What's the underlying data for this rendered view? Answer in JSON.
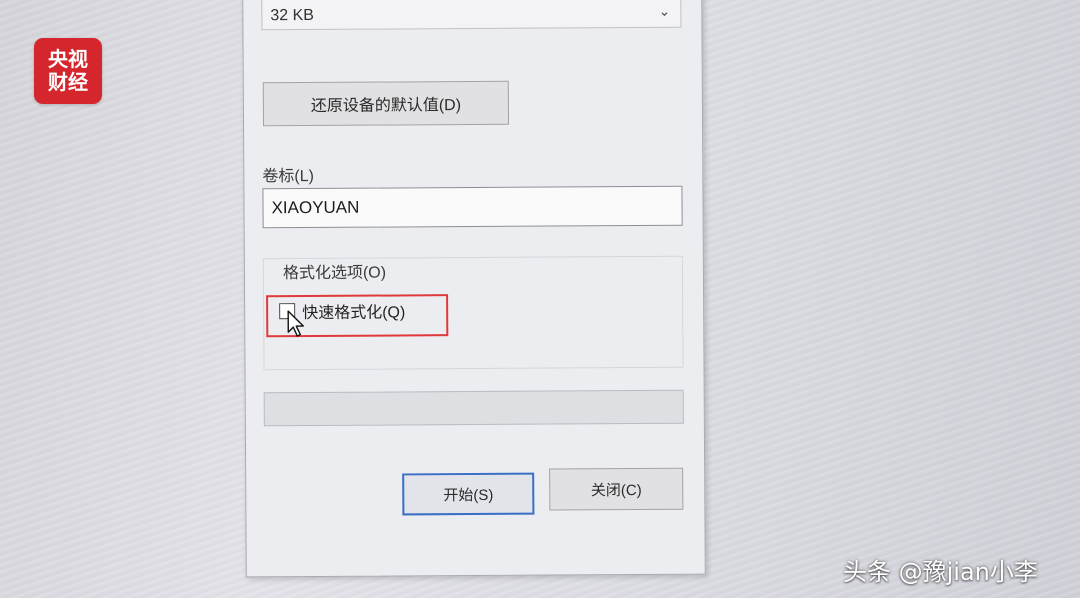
{
  "logo": {
    "line1": "央视",
    "line2": "财经"
  },
  "dialog": {
    "allocation_unit": "32 KB",
    "restore_defaults_label": "还原设备的默认值(D)",
    "volume_label_title": "卷标(L)",
    "volume_label_value": "XIAOYUAN",
    "format_options_title": "格式化选项(O)",
    "quick_format_label": "快速格式化(Q)",
    "quick_format_checked": false,
    "progress": 0,
    "start_label": "开始(S)",
    "close_label": "关闭(C)",
    "highlight_color": "#e0393b",
    "default_button_border": "#3a6fc5"
  },
  "watermark": "头条 @豫jian小李"
}
